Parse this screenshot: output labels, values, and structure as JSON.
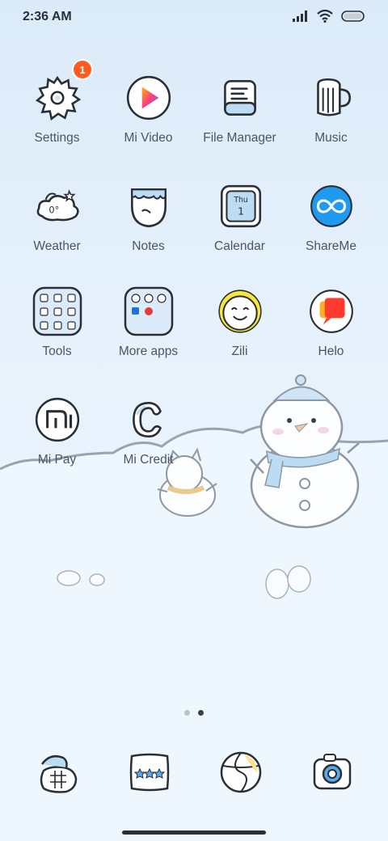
{
  "status": {
    "time": "2:36 AM"
  },
  "apps": [
    {
      "label": "Settings",
      "icon": "gear-icon",
      "badge": "1"
    },
    {
      "label": "Mi Video",
      "icon": "play-icon"
    },
    {
      "label": "File Manager",
      "icon": "folder-icon"
    },
    {
      "label": "Music",
      "icon": "music-mug-icon"
    },
    {
      "label": "Weather",
      "icon": "weather-cloud-icon",
      "icon_text": "0°"
    },
    {
      "label": "Notes",
      "icon": "notes-icon"
    },
    {
      "label": "Calendar",
      "icon": "calendar-icon",
      "day": "Thu",
      "date": "1"
    },
    {
      "label": "ShareMe",
      "icon": "shareme-icon"
    },
    {
      "label": "Tools",
      "icon": "tools-folder-icon"
    },
    {
      "label": "More apps",
      "icon": "more-apps-folder-icon"
    },
    {
      "label": "Zili",
      "icon": "zili-face-icon"
    },
    {
      "label": "Helo",
      "icon": "helo-chat-icon"
    },
    {
      "label": "Mi Pay",
      "icon": "mi-pay-icon"
    },
    {
      "label": "Mi Credit",
      "icon": "mi-credit-icon"
    }
  ],
  "dock": [
    {
      "name": "phone-basket-icon"
    },
    {
      "name": "messages-stars-icon"
    },
    {
      "name": "browser-ball-icon"
    },
    {
      "name": "camera-icon"
    }
  ],
  "page_indicator": {
    "pages": 2,
    "active": 2
  },
  "colors": {
    "sky": "#dcebf9",
    "snow": "#f2f8fe",
    "outline": "#8e98a3",
    "badge": "#ff5a1f"
  }
}
